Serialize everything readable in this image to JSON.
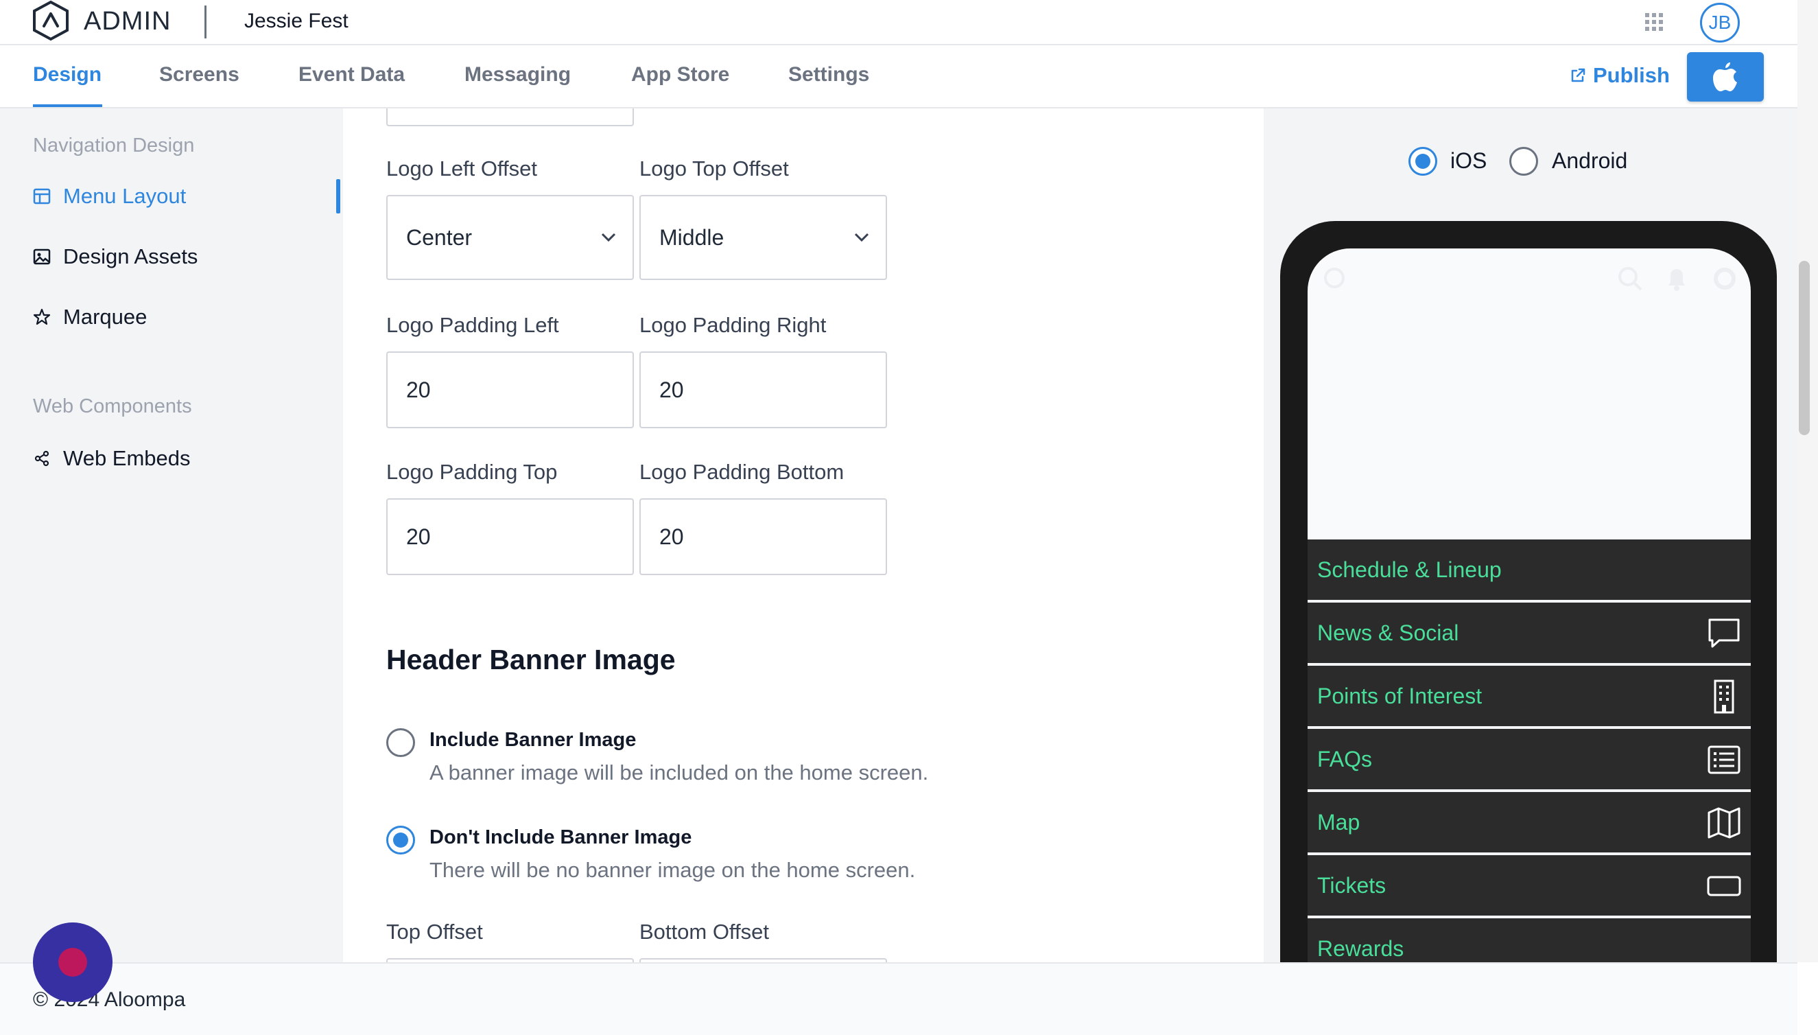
{
  "header": {
    "brand": "ADMIN",
    "app_name": "Jessie Fest",
    "avatar_initials": "JB"
  },
  "tabs": [
    {
      "label": "Design",
      "active": true
    },
    {
      "label": "Screens"
    },
    {
      "label": "Event Data"
    },
    {
      "label": "Messaging"
    },
    {
      "label": "App Store"
    },
    {
      "label": "Settings"
    }
  ],
  "publish_label": "Publish",
  "sidebar": {
    "sections": [
      {
        "title": "Navigation Design",
        "items": [
          "Menu Layout",
          "Design Assets",
          "Marquee"
        ]
      },
      {
        "title": "Web Components",
        "items": [
          "Web Embeds"
        ]
      }
    ],
    "active_item": "Menu Layout"
  },
  "form": {
    "logo_left_offset": {
      "label": "Logo Left Offset",
      "value": "Center"
    },
    "logo_top_offset": {
      "label": "Logo Top Offset",
      "value": "Middle"
    },
    "logo_padding_left": {
      "label": "Logo Padding Left",
      "value": "20"
    },
    "logo_padding_right": {
      "label": "Logo Padding Right",
      "value": "20"
    },
    "logo_padding_top": {
      "label": "Logo Padding Top",
      "value": "20"
    },
    "logo_padding_bottom": {
      "label": "Logo Padding Bottom",
      "value": "20"
    },
    "banner_section_title": "Header Banner Image",
    "banner_options": [
      {
        "title": "Include Banner Image",
        "desc": "A banner image will be included on the home screen.",
        "checked": false
      },
      {
        "title": "Don't Include Banner Image",
        "desc": "There will be no banner image on the home screen.",
        "checked": true
      }
    ],
    "top_offset_label": "Top Offset",
    "bottom_offset_label": "Bottom Offset"
  },
  "preview": {
    "os_options": [
      {
        "label": "iOS",
        "checked": true
      },
      {
        "label": "Android",
        "checked": false
      }
    ],
    "menu_items": [
      {
        "label": "Schedule & Lineup",
        "icon": "none"
      },
      {
        "label": "News & Social",
        "icon": "chat-bubble-icon"
      },
      {
        "label": "Points of Interest",
        "icon": "building-icon"
      },
      {
        "label": "FAQs",
        "icon": "list-icon"
      },
      {
        "label": "Map",
        "icon": "map-icon"
      },
      {
        "label": "Tickets",
        "icon": "ticket-icon"
      },
      {
        "label": "Rewards",
        "icon": "none"
      }
    ],
    "accent_color": "#4ade9b"
  },
  "footer": {
    "copyright": "© 2024 Aloompa"
  }
}
